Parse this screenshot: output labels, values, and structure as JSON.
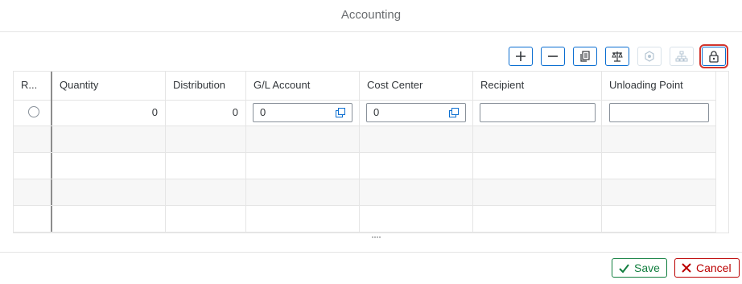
{
  "dialog": {
    "title": "Accounting"
  },
  "toolbar": {
    "buttons": [
      {
        "name": "add-row-button",
        "icon": "plus-icon",
        "enabled": true
      },
      {
        "name": "delete-row-button",
        "icon": "minus-icon",
        "enabled": true
      },
      {
        "name": "copy-button",
        "icon": "copy-icon",
        "enabled": true
      },
      {
        "name": "distribution-button",
        "icon": "balance-icon",
        "enabled": true
      },
      {
        "name": "settings-button",
        "icon": "cube-icon",
        "enabled": false
      },
      {
        "name": "hierarchy-button",
        "icon": "hierarchy-icon",
        "enabled": false
      },
      {
        "name": "lock-button",
        "icon": "lock-icon",
        "enabled": true,
        "highlighted": true
      }
    ]
  },
  "table": {
    "columns": [
      "R...",
      "Quantity",
      "Distribution",
      "G/L Account",
      "Cost Center",
      "Recipient",
      "Unloading Point"
    ],
    "rows": [
      {
        "quantity": "0",
        "distribution": "0",
        "gl_account": "0",
        "cost_center": "0",
        "recipient": "",
        "unloading_point": ""
      }
    ],
    "empty_rows": 4
  },
  "footer": {
    "save_label": "Save",
    "cancel_label": "Cancel"
  },
  "colors": {
    "accent": "#0a6ed1",
    "save": "#107e3e",
    "cancel": "#bb0000",
    "highlight": "#d2342c"
  }
}
